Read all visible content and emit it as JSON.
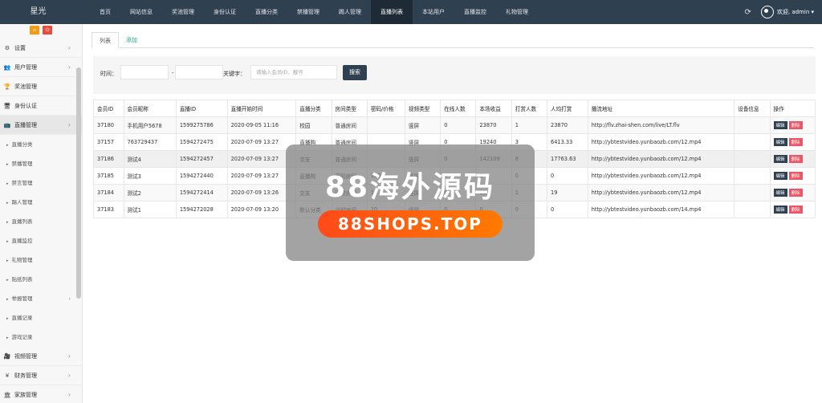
{
  "brand": "星光",
  "topnav": [
    "首页",
    "网站信息",
    "奖池管理",
    "身份认证",
    "直播分类",
    "禁播管理",
    "踢人管理",
    "直播列表",
    "本站用户",
    "直播监控",
    "礼物管理"
  ],
  "topnav_active_index": 7,
  "user": {
    "welcome": "欢迎, admin ▾"
  },
  "side_buttons": [
    "⌂",
    "⏻"
  ],
  "sidebar": [
    {
      "icon": "gear-icon",
      "glyph": "⚙",
      "label": "设置",
      "arrow": "›",
      "type": "item"
    },
    {
      "icon": "users-icon",
      "glyph": "👥",
      "label": "用户管理",
      "arrow": "›",
      "type": "item"
    },
    {
      "icon": "trophy-icon",
      "glyph": "🏆",
      "label": "奖池管理",
      "arrow": "",
      "type": "item"
    },
    {
      "icon": "monitor-icon",
      "glyph": "🖥",
      "label": "身份认证",
      "arrow": "",
      "type": "item"
    },
    {
      "icon": "tv-icon",
      "glyph": "📺",
      "label": "直播管理",
      "arrow": "›",
      "type": "item",
      "active": true
    },
    {
      "label": "直播分类",
      "type": "sub"
    },
    {
      "label": "禁播管理",
      "type": "sub"
    },
    {
      "label": "禁言管理",
      "type": "sub"
    },
    {
      "label": "踢人管理",
      "type": "sub"
    },
    {
      "label": "直播列表",
      "type": "sub"
    },
    {
      "label": "直播监控",
      "type": "sub"
    },
    {
      "label": "礼物管理",
      "type": "sub"
    },
    {
      "label": "贴纸列表",
      "type": "sub"
    },
    {
      "label": "举报管理",
      "type": "sub",
      "arrow": "›"
    },
    {
      "label": "直播记录",
      "type": "sub"
    },
    {
      "label": "游戏记录",
      "type": "sub"
    },
    {
      "icon": "video-icon",
      "glyph": "🎥",
      "label": "视频管理",
      "arrow": "›",
      "type": "item"
    },
    {
      "icon": "yen-icon",
      "glyph": "¥",
      "label": "财务管理",
      "arrow": "›",
      "type": "item"
    },
    {
      "icon": "bank-icon",
      "glyph": "🏛",
      "label": "家族管理",
      "arrow": "›",
      "type": "item"
    }
  ],
  "tabs": {
    "list": "列表",
    "add": "添加"
  },
  "filter": {
    "time_label": "时间：",
    "dash": "-",
    "keyword_label": "关键字：",
    "keyword_placeholder": "请输入会员ID、靓号",
    "search_button": "搜索"
  },
  "table": {
    "headers": [
      "会员ID",
      "会员昵称",
      "直播ID",
      "直播开始时间",
      "直播分类",
      "房间类型",
      "密码/价格",
      "视频类型",
      "在线人数",
      "本场收益",
      "打赏人数",
      "人均打赏",
      "播流地址",
      "设备信息",
      "操作"
    ],
    "rows": [
      [
        "37180",
        "手机用户5678",
        "1599275786",
        "2020-09-05 11:16",
        "校园",
        "普通房间",
        "",
        "竖屏",
        "0",
        "23870",
        "1",
        "23870",
        "http://flv.zhai-shen.com/live/LT.flv",
        ""
      ],
      [
        "37157",
        "763729437",
        "1594272475",
        "2020-07-09 13:27",
        "直播购",
        "普通房间",
        "",
        "竖屏",
        "0",
        "19240",
        "3",
        "6413.33",
        "http://ybtestvideo.yunbaozb.com/12.mp4",
        ""
      ],
      [
        "37186",
        "测试4",
        "1594272457",
        "2020-07-09 13:27",
        "交友",
        "普通房间",
        "",
        "竖屏",
        "0",
        "142109",
        "8",
        "17763.63",
        "http://ybtestvideo.yunbaozb.com/12.mp4",
        ""
      ],
      [
        "37185",
        "测试3",
        "1594272440",
        "2020-07-09 13:27",
        "直播购",
        "密码房间",
        "123",
        "竖屏",
        "0",
        "0",
        "0",
        "0",
        "http://ybtestvideo.yunbaozb.com/12.mp4",
        ""
      ],
      [
        "37184",
        "测试2",
        "1594272414",
        "2020-07-09 13:26",
        "交友",
        "门票房间",
        "10",
        "竖屏",
        "0",
        "19",
        "1",
        "19",
        "http://ybtestvideo.yunbaozb.com/12.mp4",
        ""
      ],
      [
        "37183",
        "测试1",
        "1594272028",
        "2020-07-09 13:20",
        "默认分类",
        "计时房间",
        "10",
        "竖屏",
        "0",
        "0",
        "0",
        "0",
        "http://ybtestvideo.yunbaozb.com/14.mp4",
        ""
      ]
    ],
    "edit_label": "编辑",
    "delete_label": "删除"
  },
  "watermark": {
    "title": "88海外源码",
    "domain": "88SHOPS.TOP"
  },
  "colors": {
    "topbar": "#2f4050",
    "accent": "#18a689",
    "danger": "#ed5565",
    "warning": "#f39c12"
  }
}
